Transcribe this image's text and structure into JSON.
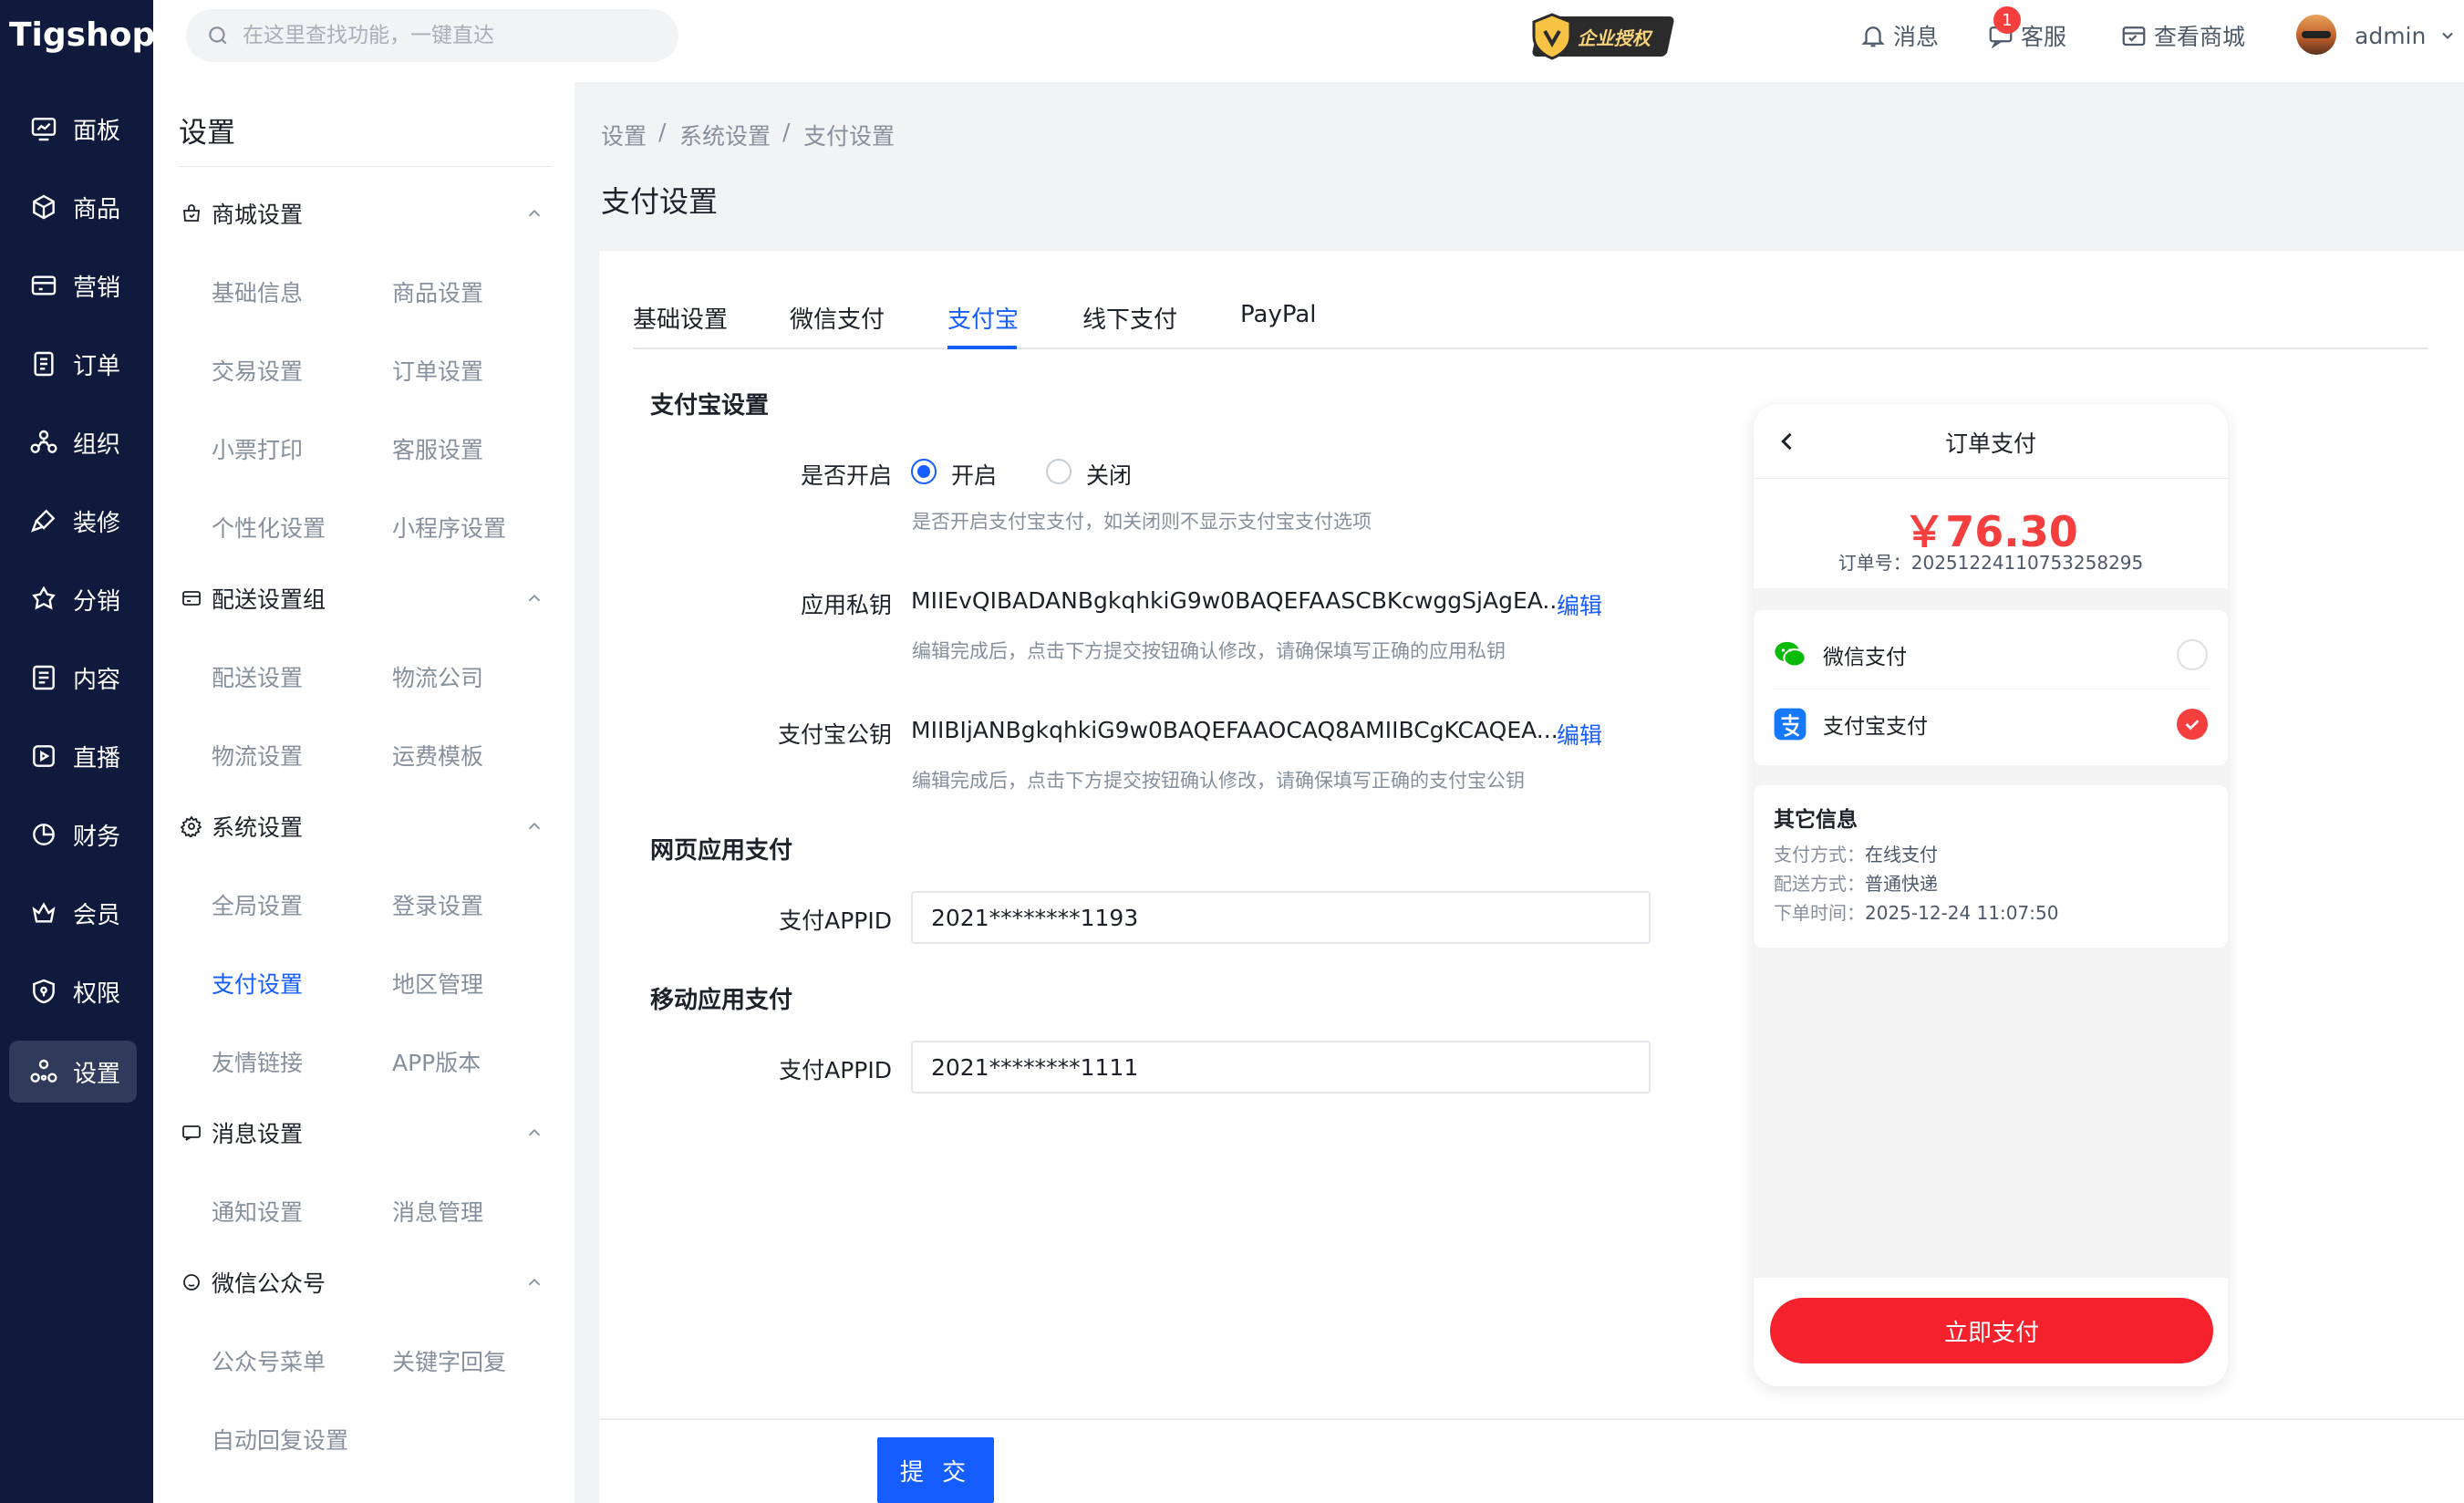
{
  "brand": {
    "logo_text": "Tigshop"
  },
  "rail": {
    "items": [
      {
        "label": "面板",
        "icon": "dashboard-icon"
      },
      {
        "label": "商品",
        "icon": "box-icon"
      },
      {
        "label": "营销",
        "icon": "marketing-icon"
      },
      {
        "label": "订单",
        "icon": "order-icon"
      },
      {
        "label": "组织",
        "icon": "org-icon"
      },
      {
        "label": "装修",
        "icon": "brush-icon"
      },
      {
        "label": "分销",
        "icon": "distribution-icon"
      },
      {
        "label": "内容",
        "icon": "content-icon"
      },
      {
        "label": "直播",
        "icon": "live-icon"
      },
      {
        "label": "财务",
        "icon": "finance-icon"
      },
      {
        "label": "会员",
        "icon": "member-icon"
      },
      {
        "label": "权限",
        "icon": "permission-icon"
      },
      {
        "label": "设置",
        "icon": "settings-icon"
      }
    ],
    "active_index": 12
  },
  "topbar": {
    "search_placeholder": "在这里查找功能，一键直达",
    "enterprise_label": "企业授权",
    "messages_label": "消息",
    "service_label": "客服",
    "service_badge": "1",
    "view_store_label": "查看商城",
    "user_name": "admin"
  },
  "settings_panel": {
    "title": "设置",
    "groups": [
      {
        "label": "商城设置",
        "icon": "store-icon",
        "items": [
          "基础信息",
          "商品设置",
          "交易设置",
          "订单设置",
          "小票打印",
          "客服设置",
          "个性化设置",
          "小程序设置"
        ]
      },
      {
        "label": "配送设置组",
        "icon": "delivery-icon",
        "items": [
          "配送设置",
          "物流公司",
          "物流设置",
          "运费模板"
        ]
      },
      {
        "label": "系统设置",
        "icon": "system-gear-icon",
        "items": [
          "全局设置",
          "登录设置",
          "支付设置",
          "地区管理",
          "友情链接",
          "APP版本"
        ]
      },
      {
        "label": "消息设置",
        "icon": "message-settings-icon",
        "items": [
          "通知设置",
          "消息管理"
        ]
      },
      {
        "label": "微信公众号",
        "icon": "wechat-oa-icon",
        "items": [
          "公众号菜单",
          "关键字回复",
          "自动回复设置"
        ]
      }
    ],
    "active_item": "支付设置"
  },
  "breadcrumb": [
    "设置",
    "系统设置",
    "支付设置"
  ],
  "page_title": "支付设置",
  "tabs": [
    "基础设置",
    "微信支付",
    "支付宝",
    "线下支付",
    "PayPal"
  ],
  "active_tab": "支付宝",
  "form": {
    "section_alipay": "支付宝设置",
    "enable_label": "是否开启",
    "enable_on": "开启",
    "enable_off": "关闭",
    "enable_hint": "是否开启支付宝支付，如关闭则不显示支付宝支付选项",
    "private_key_label": "应用私钥",
    "private_key_value": "MIIEvQIBADANBgkqhkiG9w0BAQEFAASCBKcwggSjAgEA...",
    "private_key_edit": "编辑",
    "private_key_hint": "编辑完成后，点击下方提交按钮确认修改，请确保填写正确的应用私钥",
    "public_key_label": "支付宝公钥",
    "public_key_value": "MIIBIjANBgkqhkiG9w0BAQEFAAOCAQ8AMIIBCgKCAQEA...",
    "public_key_edit": "编辑",
    "public_key_hint": "编辑完成后，点击下方提交按钮确认修改，请确保填写正确的支付宝公钥",
    "section_web": "网页应用支付",
    "web_appid_label": "支付APPID",
    "web_appid_value": "2021********1193",
    "section_mobile": "移动应用支付",
    "mobile_appid_label": "支付APPID",
    "mobile_appid_value": "2021********1111",
    "submit_label": "提 交"
  },
  "preview": {
    "title": "订单支付",
    "amount": "￥76.30",
    "order_no": "订单号：20251224110753258295",
    "methods": [
      {
        "label": "微信支付",
        "icon": "wechat-pay-icon",
        "selected": false
      },
      {
        "label": "支付宝支付",
        "icon": "alipay-icon",
        "selected": true
      }
    ],
    "other_title": "其它信息",
    "info": [
      {
        "k": "支付方式：",
        "v": "在线支付"
      },
      {
        "k": "配送方式：",
        "v": "普通快递"
      },
      {
        "k": "下单时间：",
        "v": "2025-12-24 11:07:50"
      }
    ],
    "pay_button": "立即支付"
  },
  "colors": {
    "primary": "#165dff",
    "rail_bg": "#0f1a3d",
    "danger": "#f53f3f"
  }
}
